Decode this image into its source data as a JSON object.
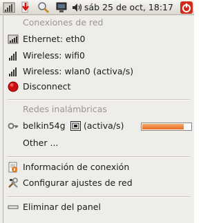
{
  "panel": {
    "clock": "sáb 25 de oct, 18:17",
    "icons": [
      "network-manager-icon",
      "download-icon",
      "search-icon",
      "monitor-icon",
      "volume-icon",
      "power-icon"
    ]
  },
  "menu": {
    "wired_header": "Conexiones de red",
    "items": [
      {
        "label": "Ethernet: eth0",
        "icon": "wired-network-icon"
      },
      {
        "label": "Wireless: wifi0",
        "icon": "wireless-signal-icon"
      },
      {
        "label": "Wireless: wlan0 (activa/s)",
        "icon": "wireless-signal-icon"
      },
      {
        "label": "Disconnect",
        "icon": "stop-icon"
      }
    ],
    "wireless_header": "Redes inalámbricas",
    "network": {
      "label": "belkin54g",
      "status": "(activa/s)",
      "signal": 0.85
    },
    "other_label": "Other ...",
    "info_label": "Información de conexión",
    "config_label": "Configurar ajustes de red",
    "remove_label": "Eliminar del panel"
  }
}
